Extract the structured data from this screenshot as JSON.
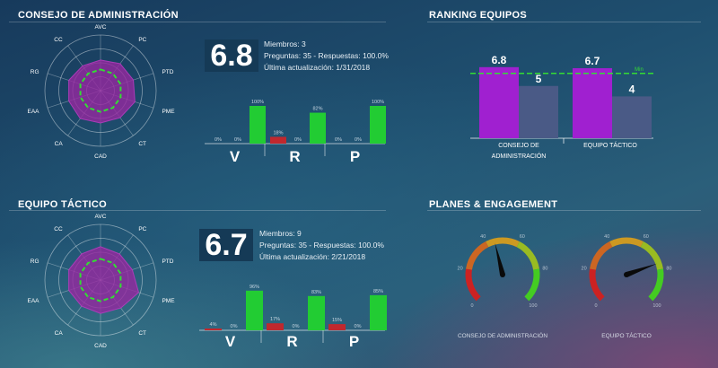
{
  "sections": {
    "consejo_title": "CONSEJO DE ADMINISTRACIÓN",
    "tactico_title": "EQUIPO TÁCTICO",
    "ranking_title": "RANKING EQUIPOS",
    "planes_title": "PLANES & ENGAGEMENT"
  },
  "radar_labels": [
    "AVC",
    "PC",
    "PTD",
    "PME",
    "CT",
    "CAD",
    "CA",
    "EAA",
    "RG",
    "CC"
  ],
  "consejo": {
    "score": "6.8",
    "miembros": "Miembros: 3",
    "preguntas": "Preguntas: 35 - Respuestas: 100.0%",
    "actualizacion": "Última actualización: 1/31/2018",
    "radar_values": [
      0.55,
      0.6,
      0.62,
      0.65,
      0.6,
      0.58,
      0.62,
      0.6,
      0.6,
      0.55
    ],
    "radar_min": 0.38,
    "groups": [
      "V",
      "R",
      "P"
    ],
    "bars": [
      {
        "label": "0%",
        "value": 0,
        "color": "#c0282e"
      },
      {
        "label": "0%",
        "value": 0,
        "color": "#22cc33"
      },
      {
        "label": "100%",
        "value": 100,
        "color": "#22cc33"
      },
      {
        "label": "18%",
        "value": 18,
        "color": "#c0282e"
      },
      {
        "label": "0%",
        "value": 0,
        "color": "#22cc33"
      },
      {
        "label": "82%",
        "value": 82,
        "color": "#22cc33"
      },
      {
        "label": "0%",
        "value": 0,
        "color": "#c0282e"
      },
      {
        "label": "0%",
        "value": 0,
        "color": "#22cc33"
      },
      {
        "label": "100%",
        "value": 100,
        "color": "#22cc33"
      }
    ]
  },
  "tactico": {
    "score": "6.7",
    "miembros": "Miembros: 9",
    "preguntas": "Preguntas: 35 - Respuestas: 100.0%",
    "actualizacion": "Última actualización: 2/21/2018",
    "radar_values": [
      0.6,
      0.58,
      0.6,
      0.72,
      0.62,
      0.6,
      0.58,
      0.6,
      0.6,
      0.58
    ],
    "radar_min": 0.38,
    "groups": [
      "V",
      "R",
      "P"
    ],
    "bars": [
      {
        "label": "4%",
        "value": 4,
        "color": "#c0282e"
      },
      {
        "label": "0%",
        "value": 0,
        "color": "#22cc33"
      },
      {
        "label": "96%",
        "value": 96,
        "color": "#22cc33"
      },
      {
        "label": "17%",
        "value": 17,
        "color": "#c0282e"
      },
      {
        "label": "0%",
        "value": 0,
        "color": "#22cc33"
      },
      {
        "label": "83%",
        "value": 83,
        "color": "#22cc33"
      },
      {
        "label": "15%",
        "value": 15,
        "color": "#c0282e"
      },
      {
        "label": "0%",
        "value": 0,
        "color": "#22cc33"
      },
      {
        "label": "85%",
        "value": 85,
        "color": "#22cc33"
      }
    ]
  },
  "chart_data": {
    "type": "bar",
    "categories": [
      "CONSEJO DE ADMINISTRACIÓN",
      "EQUIPO TÁCTICO"
    ],
    "series": [
      {
        "values": [
          6.8,
          6.7
        ],
        "labels": [
          "6.8",
          "6.7"
        ],
        "color": "#a020d0"
      },
      {
        "values": [
          5,
          4
        ],
        "labels": [
          "5",
          "4"
        ],
        "color": "#4a5a86"
      }
    ],
    "min_label": "Min",
    "min_value": 6.2,
    "ylim": [
      0,
      8.5
    ]
  },
  "ranking_axis_labels": [
    "CONSEJO DE",
    "ADMINISTRACIÓN",
    "EQUIPO TÁCTICO"
  ],
  "gauges": [
    {
      "label": "CONSEJO DE ADMINISTRACIÓN",
      "value": 45
    },
    {
      "label": "EQUIPO TÁCTICO",
      "value": 76
    }
  ],
  "gauge_ticks": [
    "0",
    "20",
    "40",
    "60",
    "80",
    "100"
  ]
}
